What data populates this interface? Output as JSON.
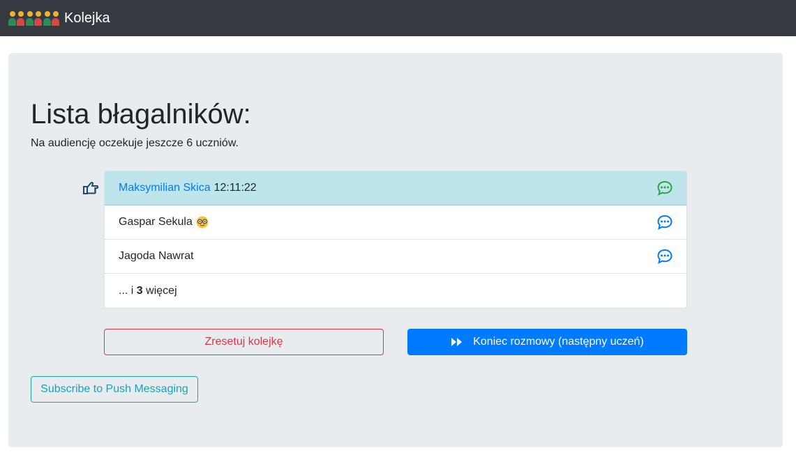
{
  "navbar": {
    "brand_label": "Kolejka",
    "brand_icon": "people-holding-hands-icon"
  },
  "main": {
    "title": "Lista błagalników:",
    "subtitle": "Na audiencję oczekuje jeszcze 6 uczniów."
  },
  "queue": {
    "items": [
      {
        "name": "Maksymilian Skica",
        "time": "12:11:22",
        "active": true,
        "chat_color": "#28a745"
      },
      {
        "name": "Gaspar Sekula",
        "emoji": "nerd-face-icon",
        "chat_color": "#007bff"
      },
      {
        "name": "Jagoda Nawrat",
        "chat_color": "#007bff"
      }
    ],
    "more_prefix": "... i",
    "more_count": "3",
    "more_suffix": "więcej"
  },
  "actions": {
    "reset_label": "Zresetuj kolejkę",
    "next_label": "Koniec rozmowy (następny uczeń)",
    "push_label": "Subscribe to Push Messaging"
  },
  "colors": {
    "navbar": "#343a40",
    "jumbotron": "#e9ecef",
    "active_row": "#bee5eb",
    "primary": "#007bff",
    "danger": "#dc3545",
    "info": "#17a2b8",
    "success": "#28a745"
  }
}
